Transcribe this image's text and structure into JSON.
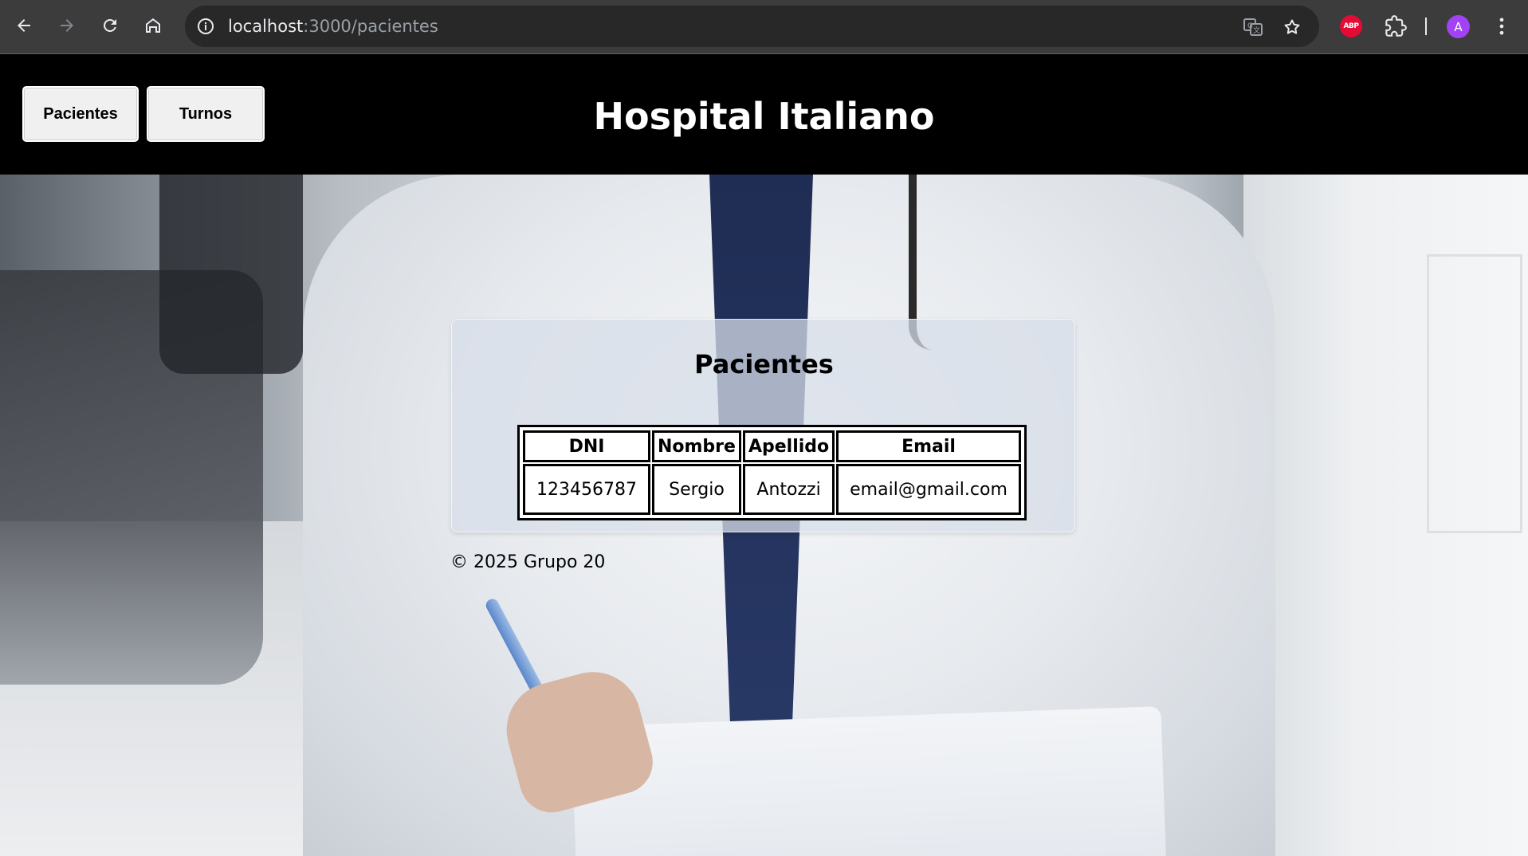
{
  "browser": {
    "url_host": "localhost",
    "url_path": ":3000/pacientes",
    "profile_initial": "A",
    "extension_badge": "ABP",
    "icons": [
      "back-icon",
      "forward-icon",
      "reload-icon",
      "home-icon",
      "site-info-icon",
      "translate-icon",
      "bookmark-star-icon",
      "adblock-plus-icon",
      "extensions-icon",
      "kebab-menu-icon"
    ]
  },
  "header": {
    "nav": [
      {
        "label": "Pacientes"
      },
      {
        "label": "Turnos"
      }
    ],
    "title": "Hospital Italiano",
    "background": "#000000"
  },
  "main": {
    "section_title": "Pacientes",
    "table": {
      "columns": [
        "DNI",
        "Nombre",
        "Apellido",
        "Email"
      ],
      "rows": [
        [
          "123456787",
          "Sergio",
          "Antozzi",
          "email@gmail.com"
        ]
      ]
    }
  },
  "footer": {
    "text": "© 2025 Grupo 20"
  }
}
